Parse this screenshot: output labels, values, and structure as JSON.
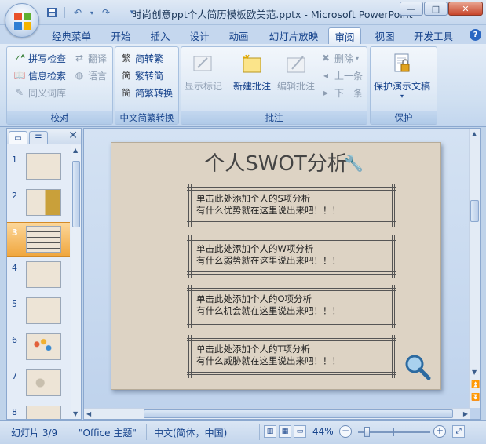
{
  "window": {
    "title": "时尚创意ppt个人简历模板欧美范.pptx - Microsoft PowerPoint",
    "minimize": "—",
    "maximize": "□",
    "close": "✕"
  },
  "qat": {
    "save_icon": "save-icon",
    "undo_icon": "undo-icon",
    "redo_icon": "redo-icon",
    "customize_icon": "chevron-down-icon"
  },
  "tabs": [
    "经典菜单",
    "开始",
    "插入",
    "设计",
    "动画",
    "幻灯片放映",
    "审阅",
    "视图",
    "开发工具"
  ],
  "active_tab": "审阅",
  "ribbon": {
    "proofing": {
      "label": "校对",
      "spell_check": "拼写检查",
      "translate": "翻译",
      "research": "信息检索",
      "language": "语言",
      "thesaurus": "同义词库"
    },
    "chinese_conversion": {
      "label": "中文简繁转换",
      "to_traditional": "简转繁",
      "to_simplified": "繁转简",
      "conversion": "简繁转换"
    },
    "comments": {
      "label": "批注",
      "show_markup": "显示标记",
      "new_comment": "新建批注",
      "edit_comment": "编辑批注",
      "delete": "删除",
      "previous": "上一条",
      "next": "下一条"
    },
    "protect": {
      "label": "保护",
      "protect_presentation": "保护演示文稿"
    }
  },
  "slides_pane": {
    "numbers": [
      "1",
      "2",
      "3",
      "4",
      "5",
      "6",
      "7",
      "8"
    ],
    "selected": "3",
    "close_icon": "close-icon"
  },
  "slide": {
    "title": "个人SWOT分析",
    "items": [
      {
        "line1": "单击此处添加个人的S项分析",
        "line2": "有什么优势就在这里说出来吧！！！"
      },
      {
        "line1": "单击此处添加个人的W项分析",
        "line2": "有什么弱势就在这里说出来吧！！！"
      },
      {
        "line1": "单击此处添加个人的O项分析",
        "line2": "有什么机会就在这里说出来吧！！！"
      },
      {
        "line1": "单击此处添加个人的T项分析",
        "line2": "有什么威胁就在这里说出来吧！！！"
      }
    ]
  },
  "status": {
    "slide_pos": "幻灯片 3/9",
    "theme": "\"Office 主题\"",
    "language": "中文(简体，中国)",
    "zoom": "44%"
  },
  "colors": {
    "accent": "#15428b",
    "ribbon": "#dbe6f4",
    "selection": "#f0a73f",
    "slide_bg": "#ddd3c4"
  }
}
